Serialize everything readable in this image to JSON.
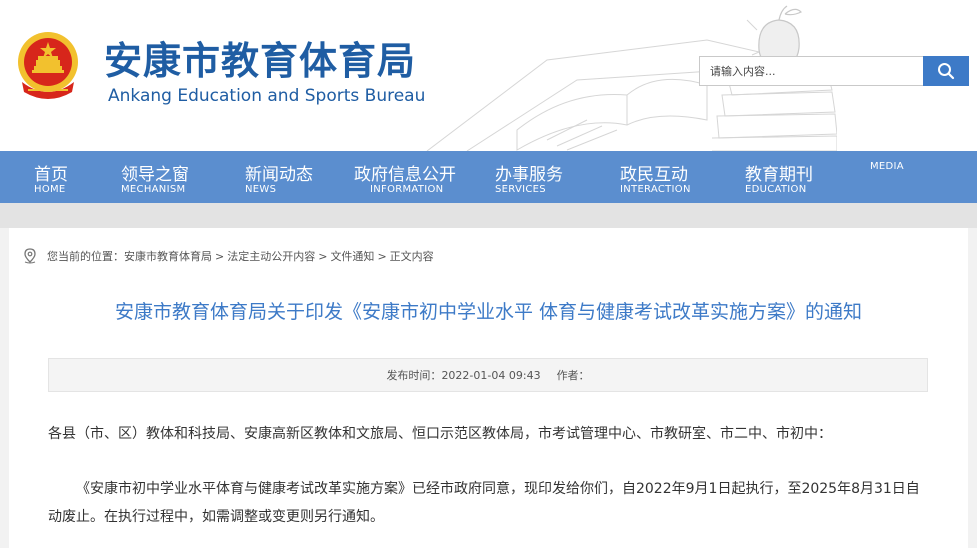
{
  "header": {
    "title": "安康市教育体育局",
    "subtitle": "Ankang Education and Sports Bureau"
  },
  "search": {
    "placeholder": "请输入内容...",
    "button_icon": "search-icon"
  },
  "nav": {
    "items": [
      {
        "cn": "首页",
        "en": "HOME"
      },
      {
        "cn": "领导之窗",
        "en": "MECHANISM"
      },
      {
        "cn": "新闻动态",
        "en": "NEWS"
      },
      {
        "cn": "政府信息公开",
        "en": "INFORMATION"
      },
      {
        "cn": "办事服务",
        "en": "SERVICES"
      },
      {
        "cn": "政民互动",
        "en": "INTERACTION"
      },
      {
        "cn": "教育期刊",
        "en": "EDUCATION"
      },
      {
        "cn": "",
        "en": "MEDIA"
      }
    ]
  },
  "breadcrumb": {
    "icon": "location-pin-icon",
    "prefix": "您当前的位置：",
    "items": [
      "安康市教育体育局",
      "法定主动公开内容",
      "文件通知",
      "正文内容"
    ],
    "separator": ">"
  },
  "article": {
    "title": "安康市教育体育局关于印发《安康市初中学业水平 体育与健康考试改革实施方案》的通知",
    "publish_label": "发布时间：",
    "publish_time": "2022-01-04 09:43",
    "author_label": "作者：",
    "author": "",
    "paragraphs": [
      "各县（市、区）教体和科技局、安康高新区教体和文旅局、恒口示范区教体局，市考试管理中心、市教研室、市二中、市初中：",
      "《安康市初中学业水平体育与健康考试改革实施方案》已经市政府同意，现印发给你们，自2022年9月1日起执行，至2025年8月31日自动废止。在执行过程中，如需调整或变更则另行通知。"
    ]
  },
  "colors": {
    "brand_blue": "#1f5da3",
    "nav_blue": "#5b8ecf",
    "title_blue": "#3d7ac7",
    "emblem_red": "#d7261b",
    "emblem_gold": "#f2c12e"
  }
}
